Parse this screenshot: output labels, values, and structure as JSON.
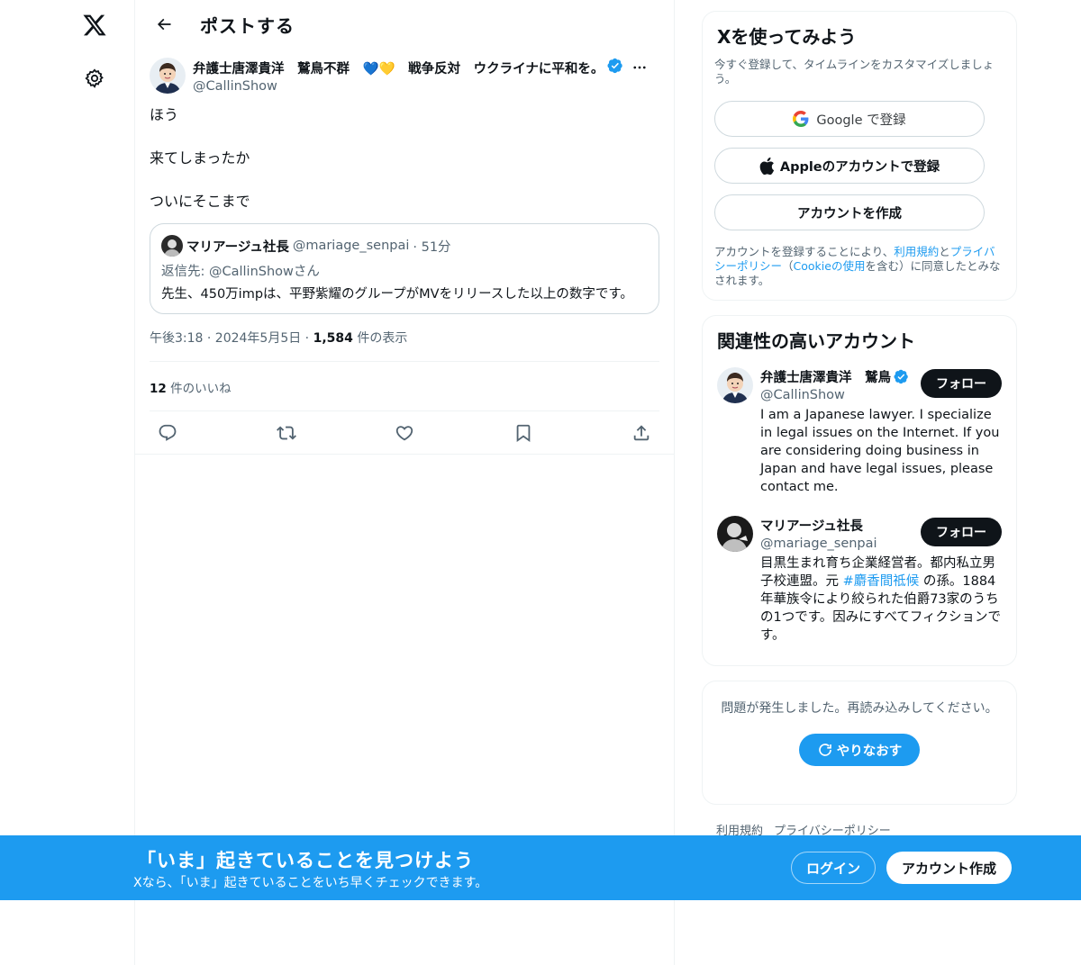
{
  "colors": {
    "accent": "#1d9bf0",
    "text": "#0f1419",
    "secondary": "#536471",
    "border": "#eff3f4"
  },
  "nav": {
    "logo_icon": "x-logo-icon",
    "settings_icon": "gear-icon"
  },
  "header": {
    "back_icon": "arrow-left-icon",
    "title": "ポストする"
  },
  "post": {
    "author_name": "弁護士唐澤貴洋　鷲鳥不群　💙💛　戦争反対　ウクライナに平和を。",
    "author_handle": "@CallinShow",
    "paragraphs": [
      "ほう",
      "来てしまったか",
      "ついにそこまで"
    ],
    "quote": {
      "name": "マリアージュ社長",
      "handle": "@mariage_senpai",
      "time": "· 51分",
      "reply_to": "返信先: @CallinShowさん",
      "text": "先生、450万impは、平野紫耀のグループがMVをリリースした以上の数字です。"
    },
    "timestamp": "午後3:18 · 2024年5月5日 · ",
    "views_count": "1,584",
    "views_label": " 件の表示",
    "likes_count": "12",
    "likes_label": " 件のいいね",
    "action_icons": [
      "reply-icon",
      "repost-icon",
      "like-icon",
      "bookmark-icon",
      "share-icon"
    ]
  },
  "signup_card": {
    "title": "Xを使ってみよう",
    "subtitle": "今すぐ登録して、タイムラインをカスタマイズしましょう。",
    "google_label": "Google で登録",
    "apple_label": "Appleのアカウントで登録",
    "create_label": "アカウントを作成",
    "legal_pre": "アカウントを登録することにより、",
    "legal_terms": "利用規約",
    "legal_and": "と",
    "legal_privacy": "プライバシーポリシー",
    "legal_mid": "（",
    "legal_cookie": "Cookieの使用",
    "legal_post": "を含む）に同意したとみなされます。"
  },
  "related": {
    "title": "関連性の高いアカウント",
    "accounts": [
      {
        "name": "弁護士唐澤貴洋　鷲鳥",
        "handle": "@CallinShow",
        "follow": "フォロー",
        "bio": "I am a Japanese lawyer. I specialize in legal issues on the Internet. If you are considering doing business in Japan and have legal issues, please contact me."
      },
      {
        "name": "マリアージュ社長",
        "handle": "@mariage_senpai",
        "follow": "フォロー",
        "bio_pre": "目黒生まれ育ち企業経営者。都内私立男子校連盟。元 ",
        "bio_link": "#麝香間祗候",
        "bio_post": " の孫。1884年華族令により絞られた伯爵73家のうちの1つです。因みにすべてフィクションです。"
      }
    ]
  },
  "error_card": {
    "message": "問題が発生しました。再読み込みしてください。",
    "retry": "やりなおす"
  },
  "footer": {
    "terms": "利用規約",
    "privacy": "プライバシーポリシー"
  },
  "banner": {
    "headline": "「いま」起きていることを見つけよう",
    "sub": "Xなら、「いま」起きていることをいち早くチェックできます。",
    "login": "ログイン",
    "signup": "アカウント作成"
  }
}
